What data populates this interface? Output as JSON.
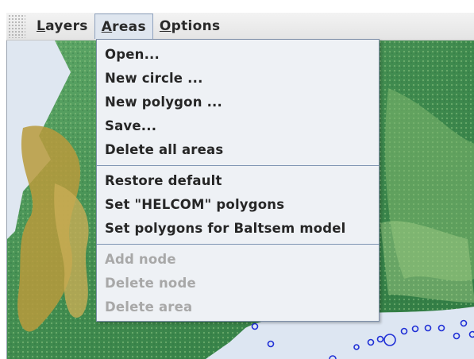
{
  "menubar": {
    "items": [
      {
        "label": "Layers",
        "mnemonic_index": 0
      },
      {
        "label": "Areas",
        "mnemonic_index": 0
      },
      {
        "label": "Options",
        "mnemonic_index": 0
      }
    ],
    "open_menu": "Areas"
  },
  "areas_menu": {
    "group1": [
      "Open...",
      "New circle ...",
      "New polygon ...",
      "Save...",
      "Delete all areas"
    ],
    "group2": [
      "Restore default",
      "Set \"HELCOM\" polygons",
      "Set polygons for Baltsem model"
    ],
    "group3_disabled": [
      "Add node",
      "Delete node",
      "Delete area"
    ]
  },
  "colors": {
    "menu_bg": "#eef1f5",
    "menu_border": "#7e8fa8",
    "disabled_text": "#a8a8a8",
    "sea": "#dde6f2",
    "land_green": "#3f8f52",
    "land_yellow": "#b59a3a",
    "marker": "#1f2fd6"
  },
  "map": {
    "description_icons": [
      "circle-marker-icon"
    ]
  }
}
